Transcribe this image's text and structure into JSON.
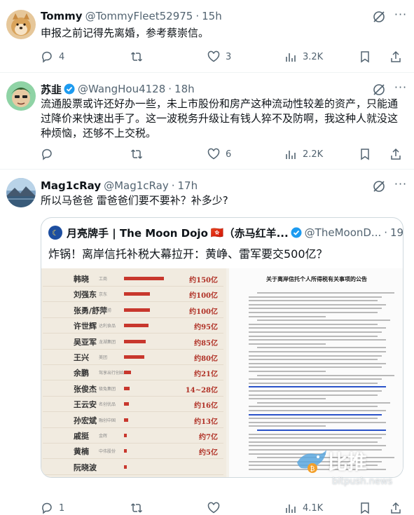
{
  "tweets": [
    {
      "name": "Tommy",
      "handle": "@TommyFleet52975",
      "sep": "·",
      "time": "15h",
      "text": "申报之前记得先离婚，参考蔡崇信。",
      "replies": "4",
      "retweets": "",
      "likes": "3",
      "views": "3.2K"
    },
    {
      "name": "苏韭",
      "handle": "@WangHou4128",
      "sep": "·",
      "time": "18h",
      "text": "流通股票或许还好办一些，未上市股份和房产这种流动性较差的资产，只能通过降价来快速出手了。这一波税务升级让有钱人猝不及防啊，我这种人就没这种烦恼，还够不上交税。",
      "replies": "",
      "retweets": "",
      "likes": "6",
      "views": "2.2K"
    },
    {
      "name": "Mag1cRay",
      "handle": "@Mag1cRay",
      "sep": "·",
      "time": "17h",
      "text": "所以马爸爸 雷爸爸们要不要补？补多少?",
      "replies": "1",
      "retweets": "",
      "likes": "",
      "views": "4.1K",
      "quote": {
        "name": "月亮牌手 | The Moon Dojo",
        "flag": "🇭🇰",
        "extra": "（赤马红羊...",
        "handle": "@TheMoonD...",
        "sep": "·",
        "time": "19h",
        "text": "炸锅！离岸信托补税大幕拉开：黄峥、雷军要交500亿？"
      }
    }
  ],
  "media": {
    "ranking": [
      {
        "name": "韩晓",
        "sub": "工商",
        "value": "约150亿",
        "frac": 0.95
      },
      {
        "name": "刘强东",
        "sub": "京东",
        "value": "约100亿",
        "frac": 0.62
      },
      {
        "name": "张勇/舒萍",
        "sub": "海底捞",
        "value": "约100亿",
        "frac": 0.62
      },
      {
        "name": "许世辉",
        "sub": "达利食品",
        "value": "约95亿",
        "frac": 0.58
      },
      {
        "name": "吴亚军",
        "sub": "龙湖集团",
        "value": "约85亿",
        "frac": 0.52
      },
      {
        "name": "王兴",
        "sub": "美团",
        "value": "约80亿",
        "frac": 0.49
      },
      {
        "name": "余鹏",
        "sub": "驾享出行创始人",
        "value": "约21亿",
        "frac": 0.16
      },
      {
        "name": "张俊杰",
        "sub": "极兔集团",
        "value": "14~28亿",
        "frac": 0.14
      },
      {
        "name": "王云安",
        "sub": "名创优品",
        "value": "约16亿",
        "frac": 0.12
      },
      {
        "name": "孙宏斌",
        "sub": "融创中国",
        "value": "约13亿",
        "frac": 0.1
      },
      {
        "name": "戚挺",
        "sub": "金辉",
        "value": "约7亿",
        "frac": 0.06
      },
      {
        "name": "黄楠",
        "sub": "中伟股份",
        "value": "约5亿",
        "frac": 0.04
      },
      {
        "name": "阮晓波",
        "sub": "",
        "value": "",
        "frac": 0.03
      }
    ],
    "doc_title": "关于离岸信托个人所得税有关事项的公告"
  },
  "watermark": {
    "cn": "比推",
    "en": "bitpush.news"
  }
}
